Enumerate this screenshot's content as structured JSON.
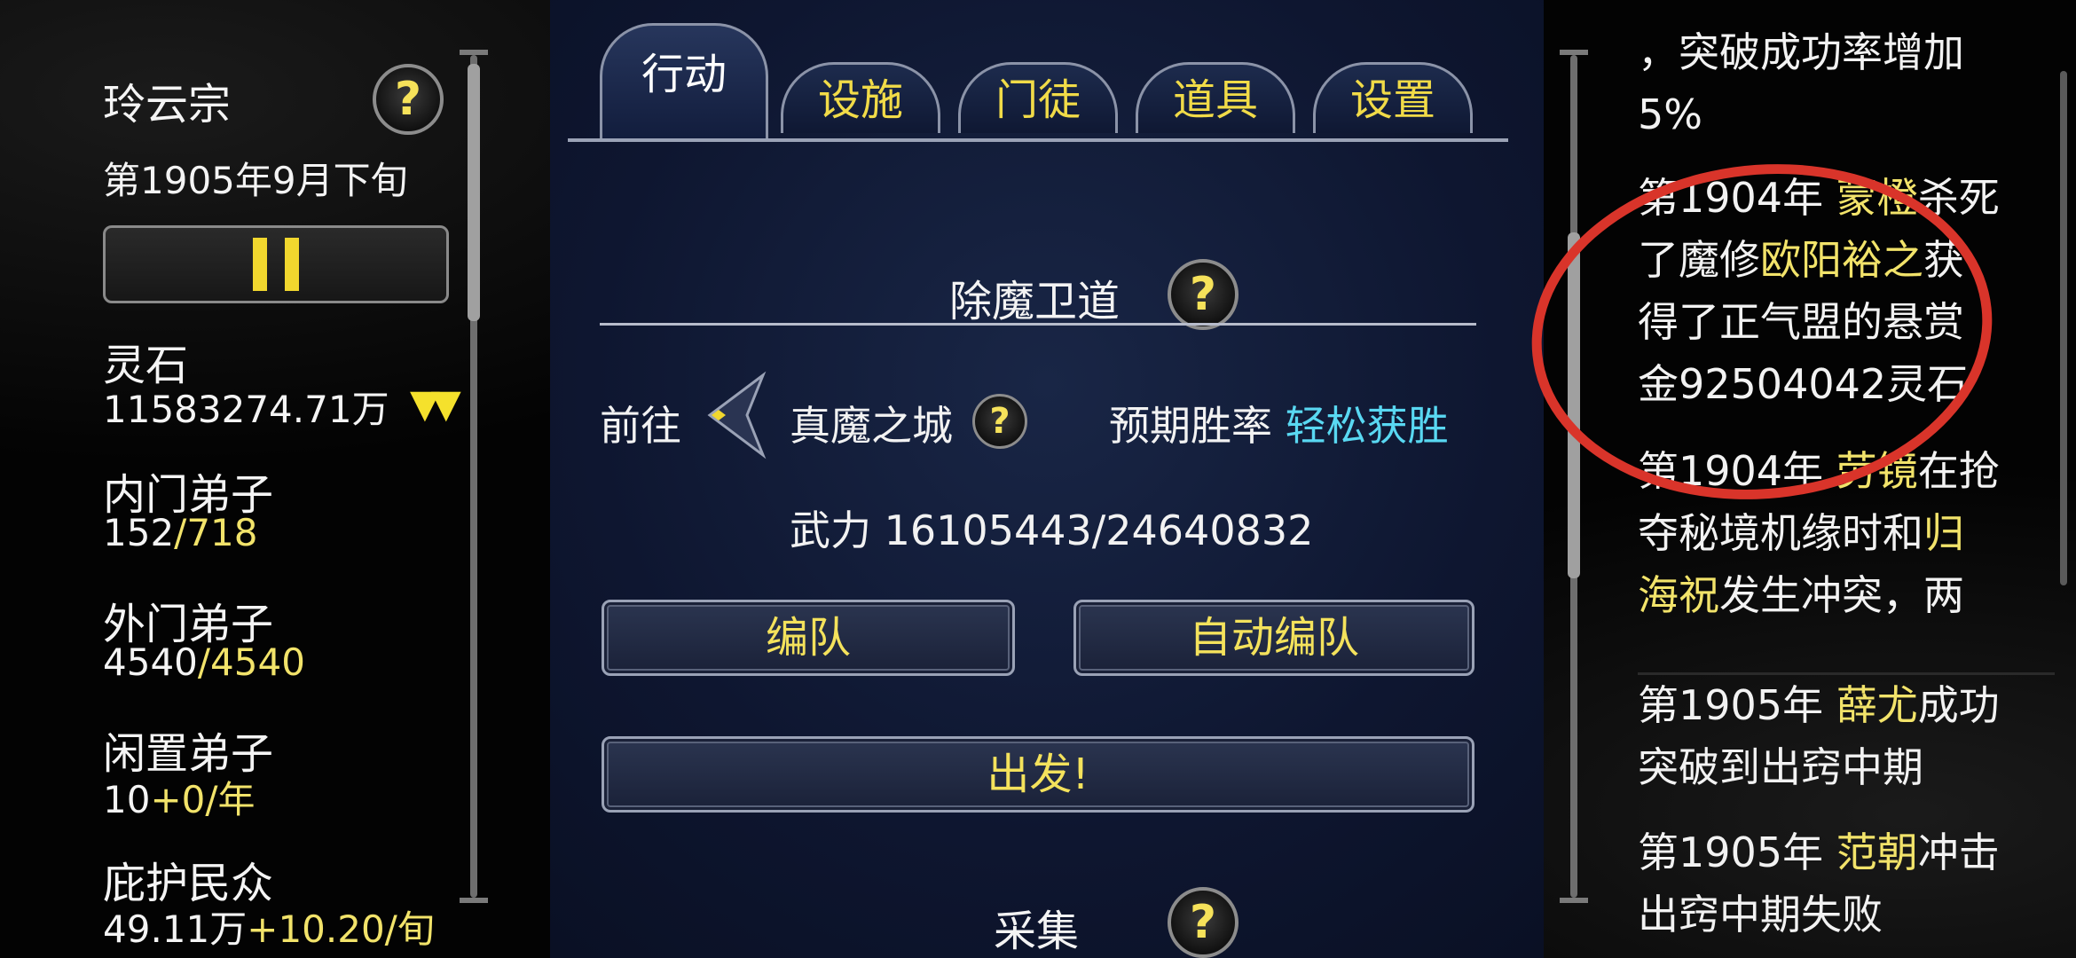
{
  "sidebar": {
    "sect_name": "玲云宗",
    "date": "第1905年9月下旬",
    "spirit_stone": {
      "label": "灵石",
      "value": "11583274.71万"
    },
    "inner_disciples": {
      "label": "内门弟子",
      "current": "152",
      "max": "/718"
    },
    "outer_disciples": {
      "label": "外门弟子",
      "current": "4540",
      "max": "/4540"
    },
    "idle_disciples": {
      "label": "闲置弟子",
      "value": "10",
      "rate": "+0/年"
    },
    "protected_people": {
      "label": "庇护民众",
      "value": "49.11万",
      "rate": "+10.20/旬"
    },
    "help_symbol": "?"
  },
  "tabs": [
    "行动",
    "设施",
    "门徒",
    "道具",
    "设置"
  ],
  "action": {
    "section_title": "除魔卫道",
    "goto_label": "前往",
    "destination": "真魔之城",
    "win_rate_label": "预期胜率",
    "win_rate_value": "轻松获胜",
    "force_label": "武力",
    "force_value": "16105443/24640832",
    "formation_button": "编队",
    "auto_formation_button": "自动编队",
    "depart_button": "出发!",
    "next_section_title": "采集"
  },
  "log": {
    "entry0": {
      "line1": "，突破成功率增加",
      "line2": "5%"
    },
    "entry1": {
      "l1_year": "第1904年 ",
      "l1_name": "蒙橙",
      "l1_rest": "杀死",
      "l2_pre": "了魔修",
      "l2_name": "欧阳裕之",
      "l2_rest": "获",
      "l3": "得了正气盟的悬赏",
      "l4": "金92504042灵石"
    },
    "entry2": {
      "l1_year": "第1904年 ",
      "l1_name": "劳镜",
      "l1_rest": "在抢",
      "l2_pre": "夺秘境机缘时和",
      "l2_name": "归",
      "l3_name": "海祝",
      "l3_rest": "发生冲突，两"
    },
    "entry3": {
      "l1_year": "第1905年 ",
      "l1_name": "薛尤",
      "l1_rest": "成功",
      "l2": "突破到出窍中期"
    },
    "entry4": {
      "l1_year": "第1905年 ",
      "l1_name": "范朝",
      "l1_rest": "冲击",
      "l2": "出窍中期失败"
    }
  },
  "colors": {
    "highlight_yellow": "#f2e36a",
    "cyan": "#59d8f2",
    "annotation_red": "#d9342a"
  }
}
